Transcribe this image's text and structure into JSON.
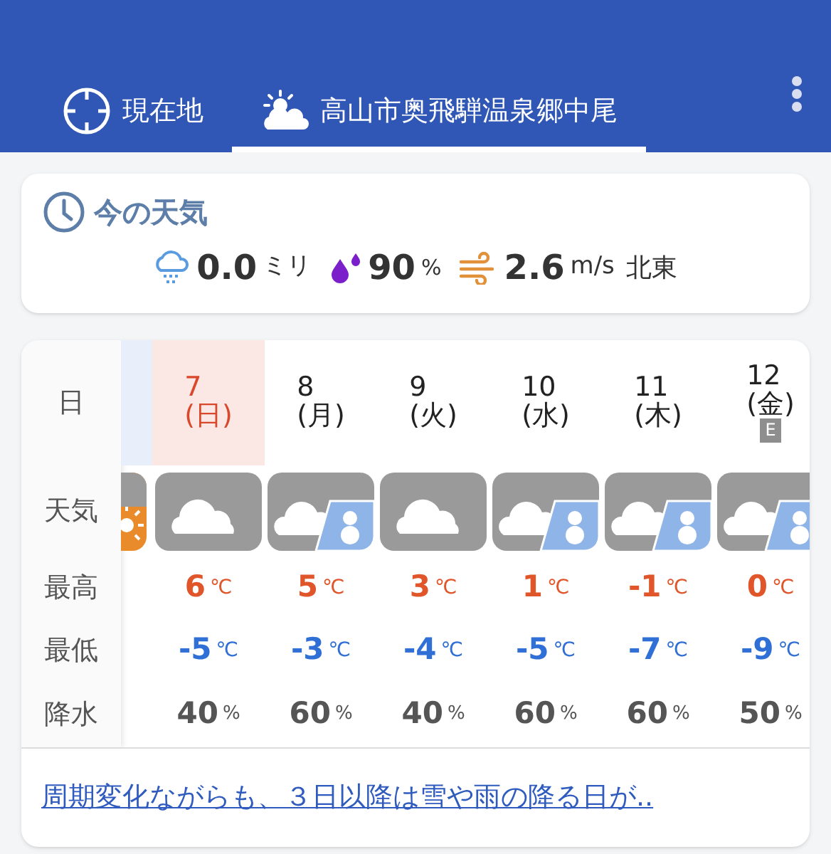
{
  "header": {
    "tabs": [
      {
        "label": "現在地",
        "selected": false
      },
      {
        "label": "高山市奥飛騨温泉郷中尾",
        "selected": true
      }
    ]
  },
  "current": {
    "title": "今の天気",
    "precip": {
      "value": "0.0",
      "unit": "ミリ"
    },
    "humidity": {
      "value": "90",
      "unit": "%"
    },
    "wind": {
      "value": "2.6",
      "unit": "m/s",
      "direction": "北東"
    }
  },
  "forecast": {
    "row_labels": [
      "日",
      "天気",
      "最高",
      "最低",
      "降水"
    ],
    "days": [
      {
        "date": "7",
        "weekday": "(日)",
        "holiday": true,
        "today": true,
        "kind": "cloudy",
        "high": "6",
        "low": "-5",
        "precip": "40"
      },
      {
        "date": "8",
        "weekday": "(月)",
        "holiday": false,
        "today": false,
        "kind": "cloudy_snow",
        "high": "5",
        "low": "-3",
        "precip": "60"
      },
      {
        "date": "9",
        "weekday": "(火)",
        "holiday": false,
        "today": false,
        "kind": "cloudy",
        "high": "3",
        "low": "-4",
        "precip": "40"
      },
      {
        "date": "10",
        "weekday": "(水)",
        "holiday": false,
        "today": false,
        "kind": "cloudy_snow",
        "high": "1",
        "low": "-5",
        "precip": "60"
      },
      {
        "date": "11",
        "weekday": "(木)",
        "holiday": false,
        "today": false,
        "kind": "cloudy_snow",
        "high": "-1",
        "low": "-7",
        "precip": "60"
      },
      {
        "date": "12",
        "weekday": "(金)",
        "holiday": false,
        "today": false,
        "badge": "E",
        "kind": "cloudy_snow",
        "high": "0",
        "low": "-9",
        "precip": "50"
      }
    ],
    "temp_unit": "℃",
    "precip_unit": "%"
  },
  "summary_link": "周期変化ながらも、３日以降は雪や雨の降る日が.."
}
